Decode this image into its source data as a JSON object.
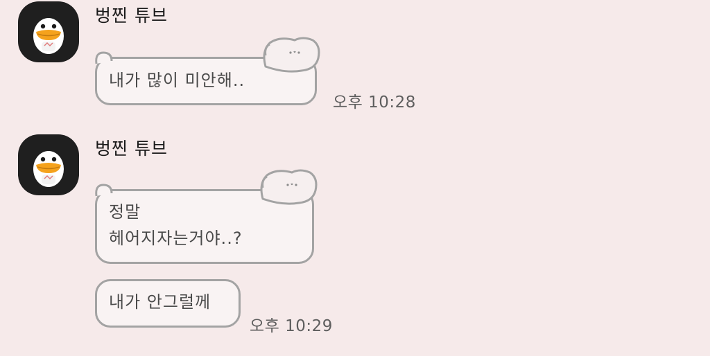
{
  "messages": [
    {
      "sender": "벙찐 튜브",
      "avatar_icon": "tube-duck-avatar-icon",
      "bubbles": [
        {
          "text": "내가 많이 미안해.."
        }
      ],
      "time": "오후 10:28"
    },
    {
      "sender": "벙찐 튜브",
      "avatar_icon": "tube-duck-avatar-icon",
      "bubbles": [
        {
          "text": "정말\n헤어지자는거야..?"
        },
        {
          "text": "내가 안그럴께"
        }
      ],
      "time": "오후 10:29"
    }
  ],
  "colors": {
    "background": "#f6eaea",
    "bubble_fill": "#f9f3f3",
    "bubble_border": "#a3a3a3",
    "avatar_bg": "#1f1f1f"
  }
}
